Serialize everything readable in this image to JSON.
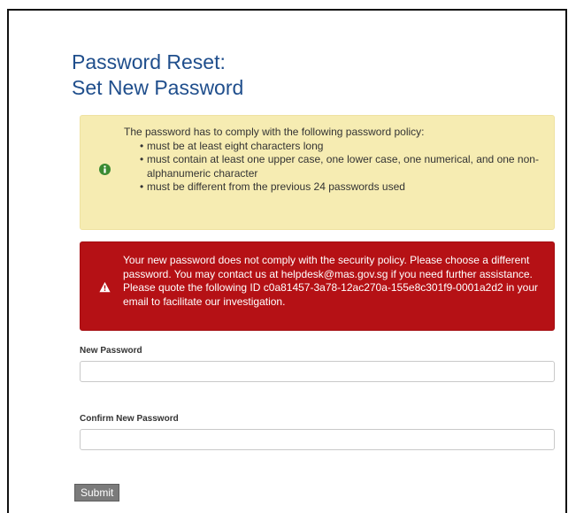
{
  "page": {
    "title_line1": "Password Reset:",
    "title_line2": "Set New Password"
  },
  "policy_notice": {
    "icon": "info-circle-icon",
    "color": "#f6ecb2",
    "intro": "The password has to comply with the following password policy:",
    "rules": [
      "must be at least eight characters long",
      "must contain at least one upper case, one lower case, one numerical, and one non-alphanumeric character",
      "must be different from the previous 24 passwords used"
    ]
  },
  "error_alert": {
    "icon": "warning-triangle-icon",
    "color": "#b51115",
    "message": "Your new password does not comply with the security policy. Please choose a different password. You may contact us at helpdesk@mas.gov.sg if you need further assistance. Please quote the following ID c0a81457-3a78-12ac270a-155e8c301f9-0001a2d2 in your email to facilitate our investigation."
  },
  "form": {
    "new_password_label": "New Password",
    "new_password_value": "",
    "confirm_password_label": "Confirm New Password",
    "confirm_password_value": "",
    "submit_label": "Submit"
  }
}
